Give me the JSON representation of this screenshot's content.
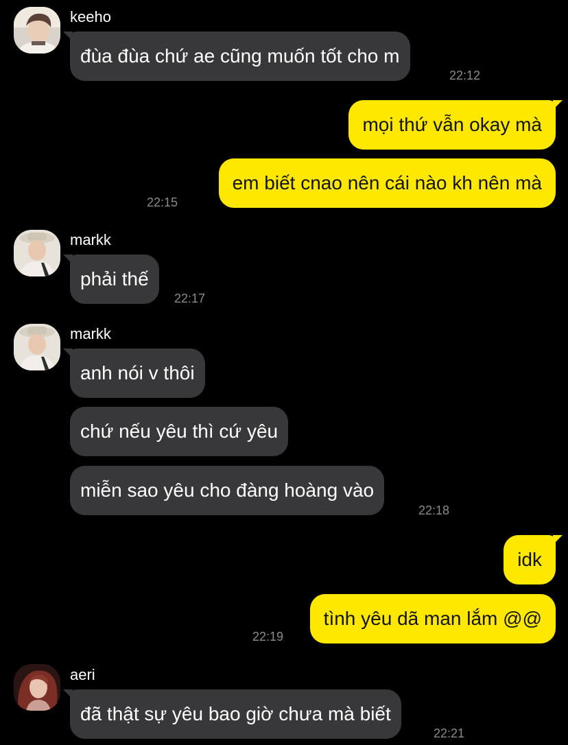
{
  "colors": {
    "background": "#000000",
    "incoming_bubble": "#38383a",
    "outgoing_bubble": "#ffe800",
    "timestamp": "#8b8b8f"
  },
  "messages": [
    {
      "sender": "keeho",
      "avatar_icon": "keeho-avatar-icon",
      "text": "đùa đùa chứ ae cũng muốn tốt cho m",
      "time": "22:12"
    },
    {
      "direction": "outgoing",
      "text": "mọi thứ vẫn okay mà"
    },
    {
      "direction": "outgoing",
      "text": "em biết cnao nên cái nào kh nên mà",
      "time": "22:15"
    },
    {
      "sender": "markk",
      "avatar_icon": "markk-avatar-icon",
      "text": "phải thế",
      "time": "22:17"
    },
    {
      "sender": "markk",
      "avatar_icon": "markk-avatar-icon",
      "text": "anh nói v thôi"
    },
    {
      "text": "chứ nếu yêu thì cứ yêu"
    },
    {
      "text": "miễn sao yêu cho đàng hoàng vào",
      "time": "22:18"
    },
    {
      "direction": "outgoing",
      "text": "idk"
    },
    {
      "direction": "outgoing",
      "text": "tình yêu dã man lắm @@",
      "time": "22:19"
    },
    {
      "sender": "aeri",
      "avatar_icon": "aeri-avatar-icon",
      "text": "đã thật sự yêu bao giờ chưa mà biết",
      "time": "22:21"
    }
  ]
}
